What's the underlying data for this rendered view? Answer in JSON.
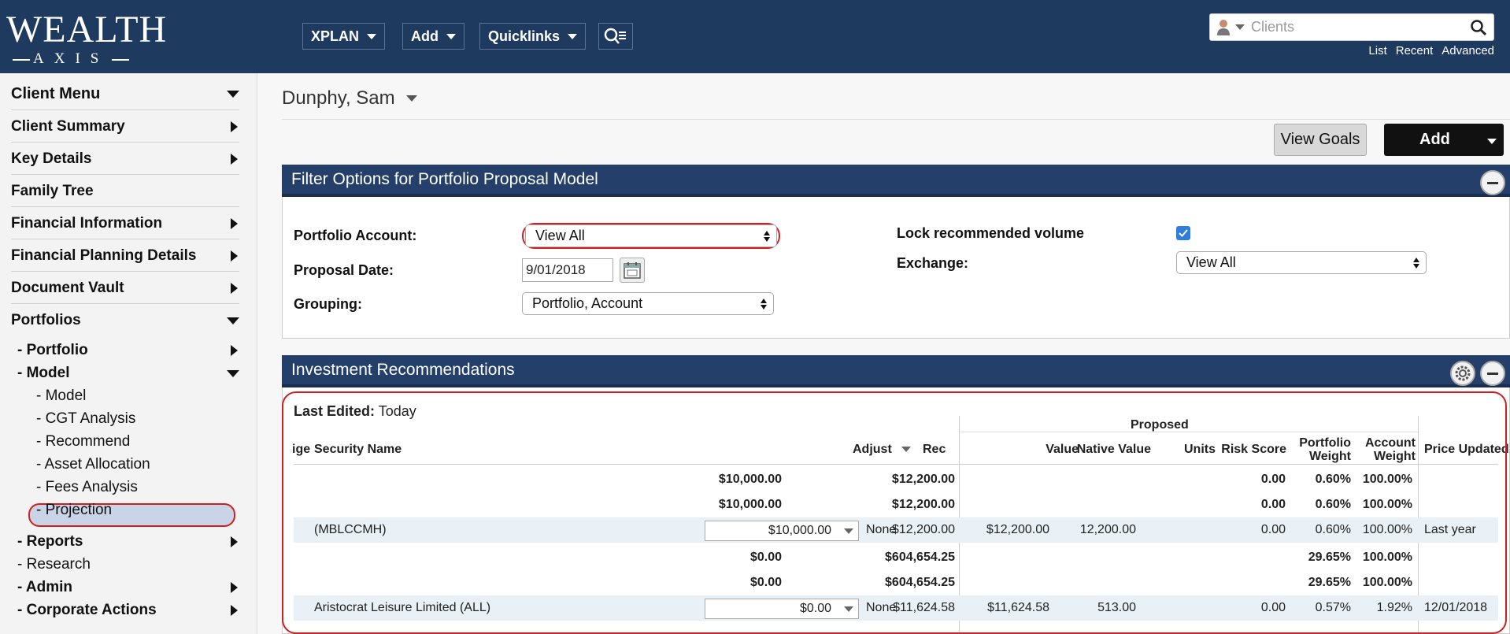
{
  "brand": {
    "logo_main": "WEALTH",
    "logo_sub": "AXIS"
  },
  "topnav": {
    "items": [
      {
        "label": "XPLAN"
      },
      {
        "label": "Add"
      },
      {
        "label": "Quicklinks"
      }
    ],
    "client_search": {
      "placeholder": "Clients",
      "links": [
        "List",
        "Recent",
        "Advanced"
      ]
    }
  },
  "sidebar": {
    "items": [
      {
        "label": "Client Menu",
        "expander": "down"
      },
      {
        "label": "Client Summary",
        "expander": "right"
      },
      {
        "label": "Key Details",
        "expander": "right"
      },
      {
        "label": "Family Tree",
        "expander": "none"
      },
      {
        "label": "Financial Information",
        "expander": "right"
      },
      {
        "label": "Financial Planning Details",
        "expander": "right"
      },
      {
        "label": "Document Vault",
        "expander": "right"
      },
      {
        "label": "Portfolios",
        "expander": "down"
      }
    ],
    "portfolios_children": [
      {
        "label": "- Portfolio",
        "expander": "right"
      },
      {
        "label": "- Model",
        "expander": "down"
      }
    ],
    "model_children": [
      "- Model",
      "- CGT Analysis",
      "- Recommend",
      "- Asset Allocation",
      "- Fees Analysis",
      "- Projection"
    ],
    "selected": "- Recommend",
    "bottom_items": [
      {
        "label": "- Reports",
        "expander": "right",
        "bold": true
      },
      {
        "label": "- Research",
        "expander": "none",
        "bold": false
      },
      {
        "label": "- Admin",
        "expander": "right",
        "bold": true
      },
      {
        "label": "- Corporate Actions",
        "expander": "right",
        "bold": true
      }
    ]
  },
  "main": {
    "client_name": "Dunphy, Sam",
    "buttons": {
      "view_goals": "View Goals",
      "add": "Add"
    },
    "filter_panel": {
      "title": "Filter Options for Portfolio Proposal Model",
      "portfolio_account_label": "Portfolio Account:",
      "portfolio_account_value": "View All",
      "proposal_date_label": "Proposal Date:",
      "proposal_date_value": "9/01/2018",
      "grouping_label": "Grouping:",
      "grouping_value": "Portfolio, Account",
      "lock_label": "Lock recommended volume",
      "lock_checked": true,
      "exchange_label": "Exchange:",
      "exchange_value": "View All"
    },
    "investment_panel": {
      "title": "Investment Recommendations",
      "last_edited_label": "Last Edited:",
      "last_edited_value": "Today",
      "group_header": "Proposed",
      "columns": {
        "ge": "ige",
        "security_name": "Security Name",
        "adjust": "Adjust",
        "rec": "Rec",
        "value": "Value",
        "native_value": "Native Value",
        "units": "Units",
        "risk_score": "Risk Score",
        "portfolio_weight": [
          "Portfolio",
          "Weight"
        ],
        "account_weight": [
          "Account",
          "Weight"
        ],
        "price_updated": "Price Updated"
      },
      "rows": [
        {
          "type": "group",
          "adjust": "$10,000.00",
          "value": "$12,200.00",
          "risk": "0.00",
          "pw": "0.60%",
          "aw": "100.00%"
        },
        {
          "type": "group",
          "adjust": "$10,000.00",
          "value": "$12,200.00",
          "risk": "0.00",
          "pw": "0.60%",
          "aw": "100.00%"
        },
        {
          "type": "security",
          "name": "(MBLCCMH)",
          "adjust": "$10,000.00",
          "rec": "None",
          "value": "$12,200.00",
          "native": "$12,200.00",
          "units": "12,200.00",
          "risk": "0.00",
          "pw": "0.60%",
          "aw": "100.00%",
          "updated": "Last year"
        },
        {
          "type": "group",
          "adjust": "$0.00",
          "value": "$604,654.25",
          "risk": "",
          "pw": "29.65%",
          "aw": "100.00%"
        },
        {
          "type": "group",
          "adjust": "$0.00",
          "value": "$604,654.25",
          "risk": "",
          "pw": "29.65%",
          "aw": "100.00%"
        },
        {
          "type": "security",
          "name": "Aristocrat Leisure Limited (ALL)",
          "adjust": "$0.00",
          "rec": "None",
          "value": "$11,624.58",
          "native": "$11,624.58",
          "units": "513.00",
          "risk": "0.00",
          "pw": "0.57%",
          "aw": "1.92%",
          "updated": "12/01/2018"
        }
      ]
    }
  }
}
